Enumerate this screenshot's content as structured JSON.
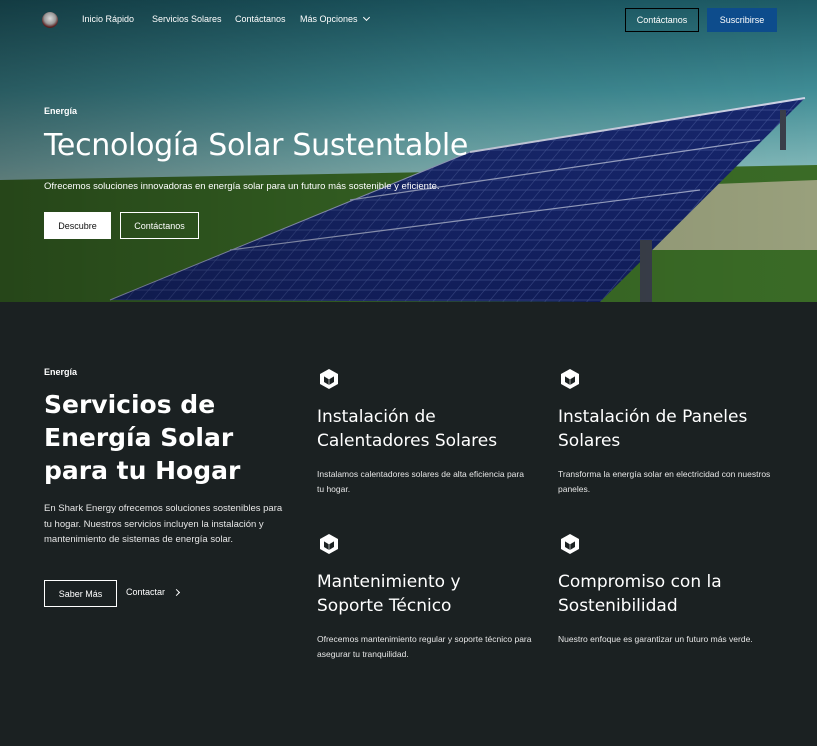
{
  "nav": {
    "links": [
      "Inicio Rápido",
      "Servicios Solares",
      "Contáctanos",
      "Más Opciones"
    ],
    "btn_outline": "Contáctanos",
    "btn_solid": "Suscribirse"
  },
  "hero": {
    "eyebrow": "Energía",
    "title": "Tecnología Solar Sustentable",
    "subtitle": "Ofrecemos soluciones innovadoras en energía solar para un futuro más sostenible y eficiente.",
    "btn_primary": "Descubre",
    "btn_secondary": "Contáctanos"
  },
  "services": {
    "eyebrow": "Energía",
    "title": "Servicios de Energía Solar para tu Hogar",
    "description": "En Shark Energy ofrecemos soluciones sostenibles para tu hogar. Nuestros servicios incluyen la instalación y mantenimiento de sistemas de energía solar.",
    "btn_more": "Saber Más",
    "link_contact": "Contactar",
    "cards": [
      {
        "icon": "cube-icon",
        "title": "Instalación de Calentadores Solares",
        "text": "Instalamos calentadores solares de alta eficiencia para tu hogar."
      },
      {
        "icon": "cube-icon",
        "title": "Instalación de Paneles Solares",
        "text": "Transforma la energía solar en electricidad con nuestros paneles."
      },
      {
        "icon": "cube-icon",
        "title": "Mantenimiento y Soporte Técnico",
        "text": "Ofrecemos mantenimiento regular y soporte técnico para asegurar tu tranquilidad."
      },
      {
        "icon": "cube-icon",
        "title": "Compromiso con la Sostenibilidad",
        "text": "Nuestro enfoque es garantizar un futuro más verde."
      }
    ]
  },
  "colors": {
    "background": "#1b2122",
    "accent": "#0d4c8c"
  }
}
